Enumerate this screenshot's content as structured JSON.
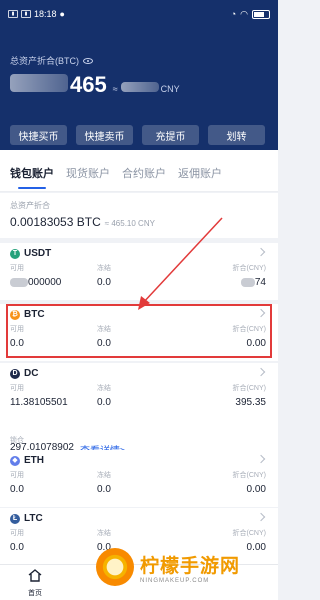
{
  "status_bar": {
    "time": "18:18",
    "battery": ""
  },
  "header": {
    "total_label": "总资产折合(BTC)",
    "total_value": "465",
    "approx_symbol": "≈",
    "total_cny_unit": "CNY",
    "actions": [
      "快捷买币",
      "快捷卖币",
      "充提币",
      "划转"
    ]
  },
  "tabs": [
    "钱包账户",
    "现货账户",
    "合约账户",
    "返佣账户"
  ],
  "summary": {
    "label": "总资产折合",
    "value": "0.00183053 BTC",
    "cny": "≈ 465.10 CNY"
  },
  "column_labels": {
    "available": "可用",
    "frozen": "冻结",
    "equivalent": "折合(CNY)"
  },
  "coins": [
    {
      "name": "USDT",
      "icon": "usdt-icon",
      "color": "#26a17b",
      "glyph": "T",
      "available": "000000",
      "frozen": "0.0",
      "equivalent": "74"
    },
    {
      "name": "BTC",
      "icon": "bitcoin-icon",
      "color": "#f7931a",
      "glyph": "₿",
      "available": "0.0",
      "frozen": "0.0",
      "equivalent": "0.00"
    },
    {
      "name": "DC",
      "icon": "dc-icon",
      "color": "#1e2a4a",
      "glyph": "D",
      "available": "11.38105501",
      "frozen": "0.0",
      "equivalent": "395.35"
    },
    {
      "name": "ETH",
      "icon": "ethereum-icon",
      "color": "#627eea",
      "glyph": "◆",
      "available": "0.0",
      "frozen": "0.0",
      "equivalent": "0.00"
    },
    {
      "name": "LTC",
      "icon": "litecoin-icon",
      "color": "#345d9d",
      "glyph": "Ł",
      "available": "0.0",
      "frozen": "0.0",
      "equivalent": "0.00"
    }
  ],
  "dc_extra": {
    "frozen_label": "锁仓",
    "frozen_value": "297.01078902",
    "detail_link": "查看详情>"
  },
  "bottom_nav": {
    "home_label": "首页"
  },
  "watermark": {
    "cn": "柠檬手游网",
    "en": "NINGMAKEUP.COM"
  },
  "colors": {
    "header_bg": "#15306b",
    "accent": "#2461e6",
    "highlight": "#e23a3a"
  }
}
